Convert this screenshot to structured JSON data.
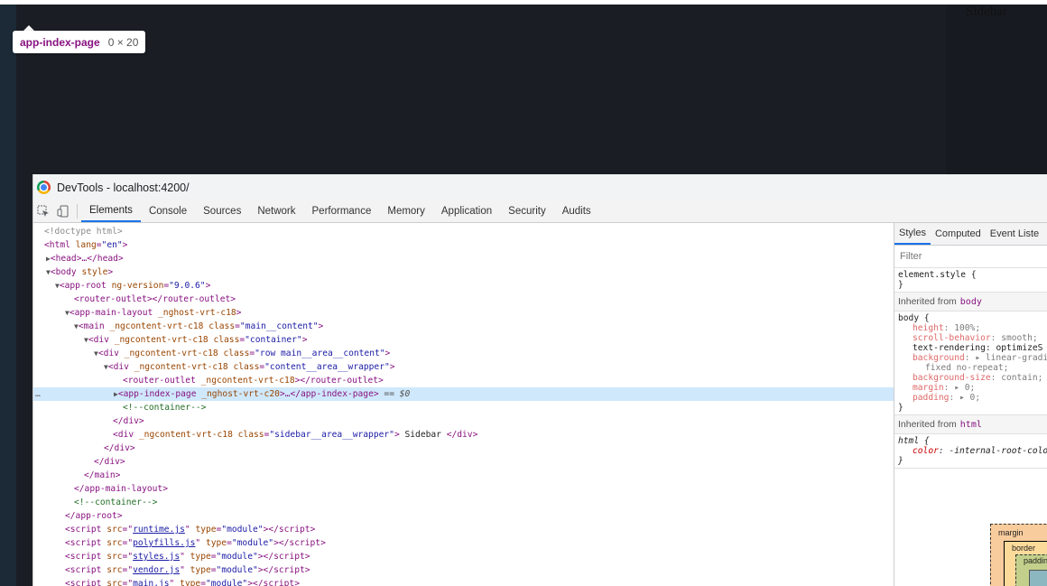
{
  "page": {
    "sidebar_text": "Sidebar",
    "tooltip": {
      "tag": "app-index-page",
      "size": "0 × 20"
    }
  },
  "devtools": {
    "title": "DevTools - localhost:4200/",
    "tabs": [
      "Elements",
      "Console",
      "Sources",
      "Network",
      "Performance",
      "Memory",
      "Application",
      "Security",
      "Audits"
    ],
    "active_tab": "Elements",
    "styles_tabs": [
      "Styles",
      "Computed",
      "Event Liste"
    ],
    "filter_placeholder": "Filter",
    "element_style": {
      "selector": "element.style {",
      "close": "}"
    },
    "inherited_body": {
      "label": "Inherited from",
      "tag": "body",
      "selector": "body {",
      "props": [
        {
          "name": "height",
          "value": "100%;"
        },
        {
          "name": "scroll-behavior",
          "value": "smooth;"
        },
        {
          "name": "text-rendering",
          "value": "optimizeS"
        },
        {
          "name": "background",
          "value": "▸ linear-gradi"
        },
        {
          "name": "",
          "value": "fixed no-repeat;"
        },
        {
          "name": "background-size",
          "value": "contain;"
        },
        {
          "name": "margin",
          "value": "▸ 0;"
        },
        {
          "name": "padding",
          "value": "▸ 0;"
        }
      ],
      "close": "}"
    },
    "inherited_html": {
      "label": "Inherited from",
      "tag": "html",
      "selector": "html {",
      "prop": {
        "name": "color",
        "value": "-internal-root-colo"
      },
      "close": "}"
    },
    "boxmodel": {
      "margin": "margin",
      "border": "border",
      "padding": "paddin",
      "dash": "–"
    },
    "dom": {
      "doctype": "<!doctype html>",
      "html_open_tag": "<html ",
      "html_lang_attr": "lang",
      "html_lang_val": "\"en\"",
      "head": "<head>…</head>",
      "body_open": "<body ",
      "body_attr": "style",
      "app_root_tag": "<app-root ",
      "app_root_attr": "ng-version",
      "app_root_val": "\"9.0.6\"",
      "router_outlet": "<router-outlet></router-outlet>",
      "main_layout_tag": "<app-main-layout ",
      "main_layout_attr": "_nghost-vrt-c18",
      "main_tag": "<main ",
      "attr_ngcontent": "_ngcontent-vrt-c18",
      "attr_class": "class",
      "main_class": "\"main__content\"",
      "div_tag": "<div ",
      "div1_class": "\"container\"",
      "div2_class": "\"row main__area__content\"",
      "div3_class": "\"content__area__wrapper\"",
      "router_outlet2_open": "<router-outlet ",
      "router_outlet2_close": "></router-outlet>",
      "index_page_open": "<app-index-page ",
      "index_page_attr": "_nghost-vrt-c20",
      "index_page_close": ">…</app-index-page>",
      "selected_marker": "== $0",
      "comment_container": "<!--container-->",
      "close_div": "</div>",
      "sidebar_class": "\"sidebar__area__wrapper\"",
      "sidebar_text": " Sidebar ",
      "close_main": "</main>",
      "close_main_layout": "</app-main-layout>",
      "close_app_root": "</app-root>",
      "scripts": [
        {
          "src": "runtime.js",
          "type": "\"module\""
        },
        {
          "src": "polyfills.js",
          "type": "\"module\""
        },
        {
          "src": "styles.js",
          "type": "\"module\""
        },
        {
          "src": "vendor.js",
          "type": "\"module\""
        },
        {
          "src": "main.js",
          "type": "\"module\""
        }
      ],
      "gutter": "…"
    }
  }
}
